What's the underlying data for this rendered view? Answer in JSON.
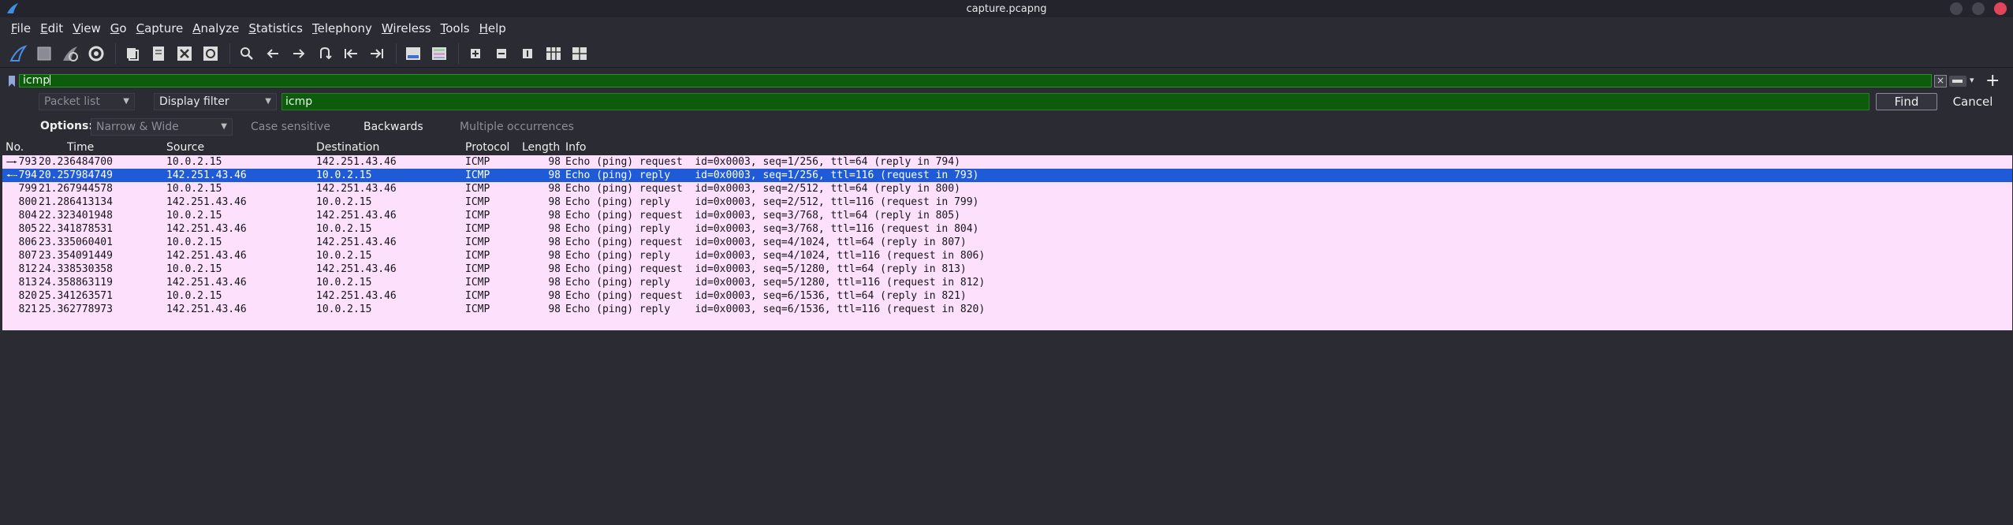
{
  "window": {
    "title": "capture.pcapng"
  },
  "menu": [
    "File",
    "Edit",
    "View",
    "Go",
    "Capture",
    "Analyze",
    "Statistics",
    "Telephony",
    "Wireless",
    "Tools",
    "Help"
  ],
  "toolbar_icons": [
    "start-capture-icon",
    "stop-capture-icon",
    "restart-capture-icon",
    "capture-options-icon",
    "open-file-icon",
    "save-file-icon",
    "close-file-icon",
    "reload-file-icon",
    "find-packet-icon",
    "go-back-icon",
    "go-forward-icon",
    "go-to-packet-icon",
    "first-packet-icon",
    "last-packet-icon",
    "auto-scroll-icon",
    "colorize-icon",
    "zoom-in-icon",
    "zoom-out-icon",
    "normal-size-icon",
    "resize-columns-icon"
  ],
  "display_filter": {
    "value": "icmp"
  },
  "find": {
    "search_in": "Packet list",
    "search_type": "Display filter",
    "search_value": "icmp",
    "find_label": "Find",
    "cancel_label": "Cancel",
    "options_label": "Options:",
    "char_width": "Narrow & Wide",
    "case_sensitive": "Case sensitive",
    "backwards": "Backwards",
    "multiple": "Multiple occurrences"
  },
  "columns": [
    "No.",
    "Time",
    "Source",
    "Destination",
    "Protocol",
    "Length",
    "Info"
  ],
  "packets": [
    {
      "no": "793",
      "time": "20.236484700",
      "src": "10.0.2.15",
      "dst": "142.251.43.46",
      "proto": "ICMP",
      "len": "98",
      "info": "Echo (ping) request  id=0x0003, seq=1/256, ttl=64 (reply in 794)"
    },
    {
      "no": "794",
      "time": "20.257984749",
      "src": "142.251.43.46",
      "dst": "10.0.2.15",
      "proto": "ICMP",
      "len": "98",
      "info": "Echo (ping) reply    id=0x0003, seq=1/256, ttl=116 (request in 793)"
    },
    {
      "no": "799",
      "time": "21.267944578",
      "src": "10.0.2.15",
      "dst": "142.251.43.46",
      "proto": "ICMP",
      "len": "98",
      "info": "Echo (ping) request  id=0x0003, seq=2/512, ttl=64 (reply in 800)"
    },
    {
      "no": "800",
      "time": "21.286413134",
      "src": "142.251.43.46",
      "dst": "10.0.2.15",
      "proto": "ICMP",
      "len": "98",
      "info": "Echo (ping) reply    id=0x0003, seq=2/512, ttl=116 (request in 799)"
    },
    {
      "no": "804",
      "time": "22.323401948",
      "src": "10.0.2.15",
      "dst": "142.251.43.46",
      "proto": "ICMP",
      "len": "98",
      "info": "Echo (ping) request  id=0x0003, seq=3/768, ttl=64 (reply in 805)"
    },
    {
      "no": "805",
      "time": "22.341878531",
      "src": "142.251.43.46",
      "dst": "10.0.2.15",
      "proto": "ICMP",
      "len": "98",
      "info": "Echo (ping) reply    id=0x0003, seq=3/768, ttl=116 (request in 804)"
    },
    {
      "no": "806",
      "time": "23.335060401",
      "src": "10.0.2.15",
      "dst": "142.251.43.46",
      "proto": "ICMP",
      "len": "98",
      "info": "Echo (ping) request  id=0x0003, seq=4/1024, ttl=64 (reply in 807)"
    },
    {
      "no": "807",
      "time": "23.354091449",
      "src": "142.251.43.46",
      "dst": "10.0.2.15",
      "proto": "ICMP",
      "len": "98",
      "info": "Echo (ping) reply    id=0x0003, seq=4/1024, ttl=116 (request in 806)"
    },
    {
      "no": "812",
      "time": "24.338530358",
      "src": "10.0.2.15",
      "dst": "142.251.43.46",
      "proto": "ICMP",
      "len": "98",
      "info": "Echo (ping) request  id=0x0003, seq=5/1280, ttl=64 (reply in 813)"
    },
    {
      "no": "813",
      "time": "24.358863119",
      "src": "142.251.43.46",
      "dst": "10.0.2.15",
      "proto": "ICMP",
      "len": "98",
      "info": "Echo (ping) reply    id=0x0003, seq=5/1280, ttl=116 (request in 812)"
    },
    {
      "no": "820",
      "time": "25.341263571",
      "src": "10.0.2.15",
      "dst": "142.251.43.46",
      "proto": "ICMP",
      "len": "98",
      "info": "Echo (ping) request  id=0x0003, seq=6/1536, ttl=64 (reply in 821)"
    },
    {
      "no": "821",
      "time": "25.362778973",
      "src": "142.251.43.46",
      "dst": "10.0.2.15",
      "proto": "ICMP",
      "len": "98",
      "info": "Echo (ping) reply    id=0x0003, seq=6/1536, ttl=116 (request in 820)"
    }
  ],
  "selected_packet_index": 1,
  "colors": {
    "row_bg": "#fce0fc",
    "selected_bg": "#1f5bd6",
    "filter_bg": "#0c5c0c"
  }
}
